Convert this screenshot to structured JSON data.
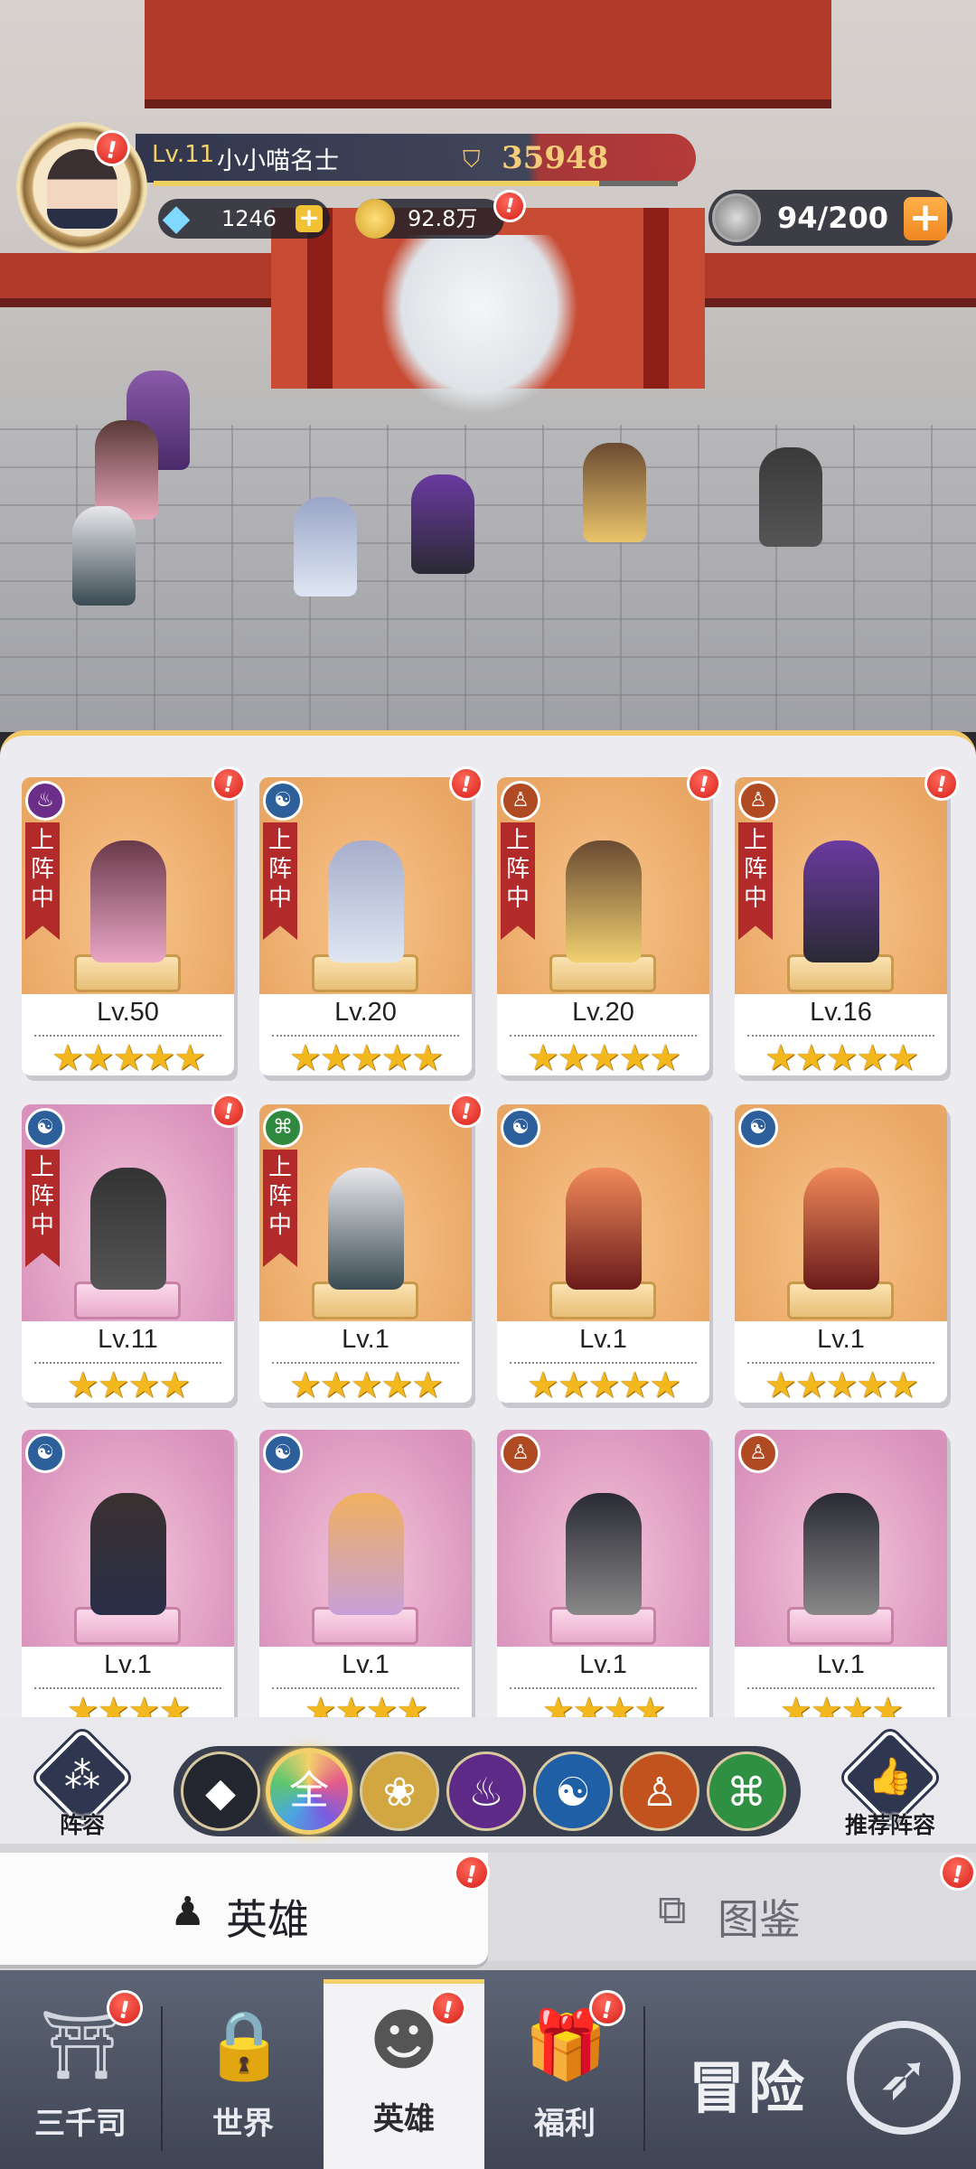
{
  "player": {
    "level": "Lv.11",
    "name": "小小喵名士",
    "power": "35948",
    "level_progress": 0.85
  },
  "resources": {
    "gems": "1246",
    "gold": "92.8万",
    "stamina": "94/200"
  },
  "heroes": [
    {
      "level": "Lv.50",
      "stars": "★★★★★",
      "faction": "fire-faction-icon",
      "deployed": true,
      "alert": true,
      "bg": "orange"
    },
    {
      "level": "Lv.20",
      "stars": "★★★★★",
      "faction": "water-faction-icon",
      "deployed": true,
      "alert": true,
      "bg": "orange"
    },
    {
      "level": "Lv.20",
      "stars": "★★★★★",
      "faction": "body-faction-icon",
      "deployed": true,
      "alert": true,
      "bg": "orange"
    },
    {
      "level": "Lv.16",
      "stars": "★★★★★",
      "faction": "body-faction-icon",
      "deployed": true,
      "alert": true,
      "bg": "orange"
    },
    {
      "level": "Lv.11",
      "stars": "★★★★",
      "faction": "water-faction-icon",
      "deployed": true,
      "alert": true,
      "bg": "pink"
    },
    {
      "level": "Lv.1",
      "stars": "★★★★★",
      "faction": "dna-faction-icon",
      "deployed": true,
      "alert": true,
      "bg": "orange"
    },
    {
      "level": "Lv.1",
      "stars": "★★★★★",
      "faction": "water-faction-icon",
      "deployed": false,
      "alert": false,
      "bg": "orange"
    },
    {
      "level": "Lv.1",
      "stars": "★★★★★",
      "faction": "water-faction-icon",
      "deployed": false,
      "alert": false,
      "bg": "orange"
    },
    {
      "level": "Lv.1",
      "stars": "★★★★",
      "faction": "water-faction-icon",
      "deployed": false,
      "alert": false,
      "bg": "pink"
    },
    {
      "level": "Lv.1",
      "stars": "★★★★",
      "faction": "water-faction-icon",
      "deployed": false,
      "alert": false,
      "bg": "pink"
    },
    {
      "level": "Lv.1",
      "stars": "★★★★",
      "faction": "body-faction-icon",
      "deployed": false,
      "alert": false,
      "bg": "pink"
    },
    {
      "level": "Lv.1",
      "stars": "★★★★",
      "faction": "body-faction-icon",
      "deployed": false,
      "alert": false,
      "bg": "pink"
    }
  ],
  "deployed_label": "上阵中",
  "filters": {
    "formation_label": "阵容",
    "recommend_label": "推荐阵容",
    "all_label": "全",
    "items": [
      "diamond-filter-icon",
      "all-filter",
      "lotus-filter-icon",
      "fire-filter-icon",
      "water-filter-icon",
      "body-filter-icon",
      "dna-filter-icon"
    ]
  },
  "tabs": {
    "heroes": "英雄",
    "atlas": "图鉴"
  },
  "nav": {
    "court": "三千司",
    "world": "世界",
    "heroes": "英雄",
    "welfare": "福利",
    "adventure": "冒险"
  },
  "alert_mark": "!",
  "colors": {
    "panel_bg": "#ecebef",
    "accent_gold": "#f4d06a",
    "alert_red": "#d61f18",
    "ribbon_red": "#b22a2a"
  }
}
